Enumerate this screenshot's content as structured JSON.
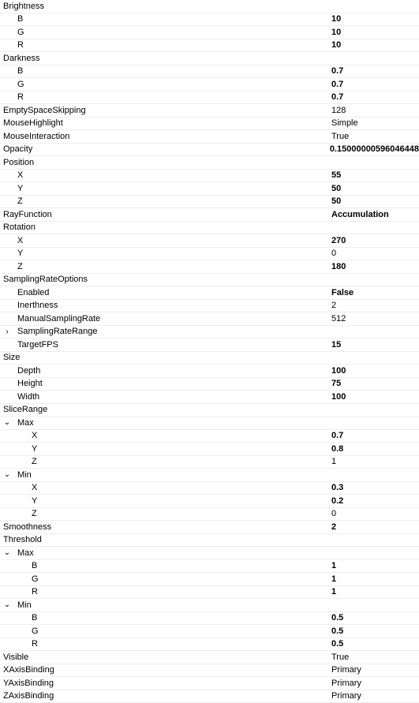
{
  "rows": [
    {
      "indent": 0,
      "label": "Brightness",
      "value": "",
      "bold": false,
      "exp": ""
    },
    {
      "indent": 1,
      "label": "B",
      "value": "10",
      "bold": true,
      "exp": ""
    },
    {
      "indent": 1,
      "label": "G",
      "value": "10",
      "bold": true,
      "exp": ""
    },
    {
      "indent": 1,
      "label": "R",
      "value": "10",
      "bold": true,
      "exp": ""
    },
    {
      "indent": 0,
      "label": "Darkness",
      "value": "",
      "bold": false,
      "exp": ""
    },
    {
      "indent": 1,
      "label": "B",
      "value": "0.7",
      "bold": true,
      "exp": ""
    },
    {
      "indent": 1,
      "label": "G",
      "value": "0.7",
      "bold": true,
      "exp": ""
    },
    {
      "indent": 1,
      "label": "R",
      "value": "0.7",
      "bold": true,
      "exp": ""
    },
    {
      "indent": 0,
      "label": "EmptySpaceSkipping",
      "value": "128",
      "bold": false,
      "exp": ""
    },
    {
      "indent": 0,
      "label": "MouseHighlight",
      "value": "Simple",
      "bold": false,
      "exp": ""
    },
    {
      "indent": 0,
      "label": "MouseInteraction",
      "value": "True",
      "bold": false,
      "exp": ""
    },
    {
      "indent": 0,
      "label": "Opacity",
      "value": "0.15000000596046448",
      "bold": true,
      "exp": ""
    },
    {
      "indent": 0,
      "label": "Position",
      "value": "",
      "bold": false,
      "exp": ""
    },
    {
      "indent": 1,
      "label": "X",
      "value": "55",
      "bold": true,
      "exp": ""
    },
    {
      "indent": 1,
      "label": "Y",
      "value": "50",
      "bold": true,
      "exp": ""
    },
    {
      "indent": 1,
      "label": "Z",
      "value": "50",
      "bold": true,
      "exp": ""
    },
    {
      "indent": 0,
      "label": "RayFunction",
      "value": "Accumulation",
      "bold": true,
      "exp": ""
    },
    {
      "indent": 0,
      "label": "Rotation",
      "value": "",
      "bold": false,
      "exp": ""
    },
    {
      "indent": 1,
      "label": "X",
      "value": "270",
      "bold": true,
      "exp": ""
    },
    {
      "indent": 1,
      "label": "Y",
      "value": "0",
      "bold": false,
      "exp": ""
    },
    {
      "indent": 1,
      "label": "Z",
      "value": "180",
      "bold": true,
      "exp": ""
    },
    {
      "indent": 0,
      "label": "SamplingRateOptions",
      "value": "",
      "bold": false,
      "exp": ""
    },
    {
      "indent": 1,
      "label": "Enabled",
      "value": "False",
      "bold": true,
      "exp": ""
    },
    {
      "indent": 1,
      "label": "Inerthness",
      "value": "2",
      "bold": false,
      "exp": ""
    },
    {
      "indent": 1,
      "label": "ManualSamplingRate",
      "value": "512",
      "bold": false,
      "exp": ""
    },
    {
      "indent": 1,
      "label": "SamplingRateRange",
      "value": "",
      "bold": false,
      "exp": "right"
    },
    {
      "indent": 1,
      "label": "TargetFPS",
      "value": "15",
      "bold": true,
      "exp": ""
    },
    {
      "indent": 0,
      "label": "Size",
      "value": "",
      "bold": false,
      "exp": ""
    },
    {
      "indent": 1,
      "label": "Depth",
      "value": "100",
      "bold": true,
      "exp": ""
    },
    {
      "indent": 1,
      "label": "Height",
      "value": "75",
      "bold": true,
      "exp": ""
    },
    {
      "indent": 1,
      "label": "Width",
      "value": "100",
      "bold": true,
      "exp": ""
    },
    {
      "indent": 0,
      "label": "SliceRange",
      "value": "",
      "bold": false,
      "exp": ""
    },
    {
      "indent": 1,
      "label": "Max",
      "value": "",
      "bold": false,
      "exp": "down"
    },
    {
      "indent": 2,
      "label": "X",
      "value": "0.7",
      "bold": true,
      "exp": ""
    },
    {
      "indent": 2,
      "label": "Y",
      "value": "0.8",
      "bold": true,
      "exp": ""
    },
    {
      "indent": 2,
      "label": "Z",
      "value": "1",
      "bold": false,
      "exp": ""
    },
    {
      "indent": 1,
      "label": "Min",
      "value": "",
      "bold": false,
      "exp": "down"
    },
    {
      "indent": 2,
      "label": "X",
      "value": "0.3",
      "bold": true,
      "exp": ""
    },
    {
      "indent": 2,
      "label": "Y",
      "value": "0.2",
      "bold": true,
      "exp": ""
    },
    {
      "indent": 2,
      "label": "Z",
      "value": "0",
      "bold": false,
      "exp": ""
    },
    {
      "indent": 0,
      "label": "Smoothness",
      "value": "2",
      "bold": true,
      "exp": ""
    },
    {
      "indent": 0,
      "label": "Threshold",
      "value": "",
      "bold": false,
      "exp": ""
    },
    {
      "indent": 1,
      "label": "Max",
      "value": "",
      "bold": false,
      "exp": "down"
    },
    {
      "indent": 2,
      "label": "B",
      "value": "1",
      "bold": true,
      "exp": ""
    },
    {
      "indent": 2,
      "label": "G",
      "value": "1",
      "bold": true,
      "exp": ""
    },
    {
      "indent": 2,
      "label": "R",
      "value": "1",
      "bold": true,
      "exp": ""
    },
    {
      "indent": 1,
      "label": "Min",
      "value": "",
      "bold": false,
      "exp": "down"
    },
    {
      "indent": 2,
      "label": "B",
      "value": "0.5",
      "bold": true,
      "exp": ""
    },
    {
      "indent": 2,
      "label": "G",
      "value": "0.5",
      "bold": true,
      "exp": ""
    },
    {
      "indent": 2,
      "label": "R",
      "value": "0.5",
      "bold": true,
      "exp": ""
    },
    {
      "indent": 0,
      "label": "Visible",
      "value": "True",
      "bold": false,
      "exp": ""
    },
    {
      "indent": 0,
      "label": "XAxisBinding",
      "value": "Primary",
      "bold": false,
      "exp": ""
    },
    {
      "indent": 0,
      "label": "YAxisBinding",
      "value": "Primary",
      "bold": false,
      "exp": ""
    },
    {
      "indent": 0,
      "label": "ZAxisBinding",
      "value": "Primary",
      "bold": false,
      "exp": ""
    }
  ]
}
